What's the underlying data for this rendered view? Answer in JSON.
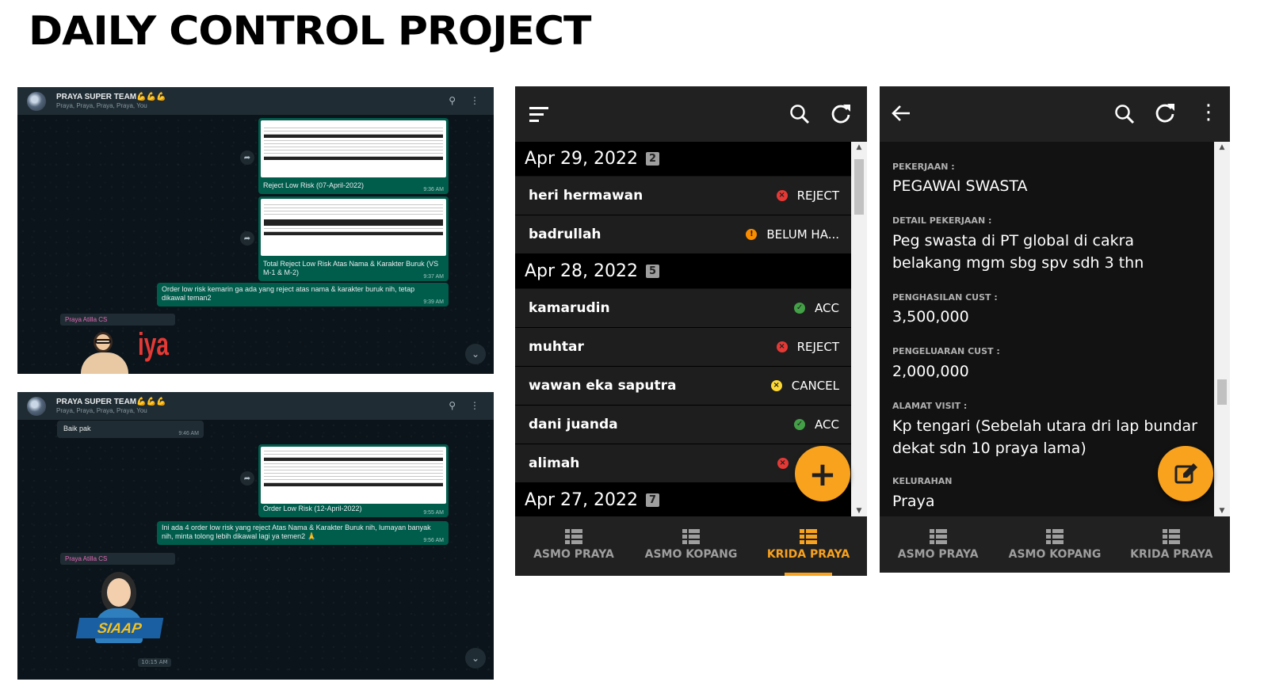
{
  "page": {
    "title": "DAILY CONTROL PROJECT"
  },
  "whatsapp_top": {
    "group_name": "PRAYA SUPER TEAM💪💪💪",
    "members": "Praya, Praya, Praya, Praya, You",
    "messages": [
      {
        "caption": "Reject Low Risk (07-April-2022)",
        "time": "9:36 AM"
      },
      {
        "caption": "Total Reject Low Risk Atas Nama & Karakter Buruk (VS M-1 & M-2)",
        "time": "9:37 AM"
      },
      {
        "text": "Order low risk kemarin ga ada yang reject atas nama & karakter buruk nih, tetap dikawal teman2",
        "time": "9:39 AM"
      }
    ],
    "sender": "Praya Atilla CS",
    "sticker_text": "iya"
  },
  "whatsapp_bottom": {
    "group_name": "PRAYA SUPER TEAM💪💪💪",
    "members": "Praya, Praya, Praya, Praya, You",
    "messages": [
      {
        "text": "Baik pak",
        "time": "9:46 AM"
      },
      {
        "caption": "Order Low Risk (12-April-2022)",
        "time": "9:55 AM"
      },
      {
        "text": "Ini ada 4 order low risk yang reject Atas Nama & Karakter Buruk nih, lumayan banyak nih, minta tolong lebih dikawal lagi ya temen2 🙏",
        "time": "9:56 AM"
      }
    ],
    "sender": "Praya Atilla CS",
    "sticker_text": "SIAAP",
    "sticker_time": "10:15 AM"
  },
  "list_app": {
    "groups": [
      {
        "date": "Apr 29, 2022",
        "count": "2",
        "rows": [
          {
            "name": "heri hermawan",
            "status": "REJECT",
            "status_icon": "reject-icon",
            "color": "#e53935"
          },
          {
            "name": "badrullah",
            "status": "BELUM HA...",
            "status_icon": "pending-icon",
            "color": "#fb8c00"
          }
        ]
      },
      {
        "date": "Apr 28, 2022",
        "count": "5",
        "rows": [
          {
            "name": "kamarudin",
            "status": "ACC",
            "status_icon": "check-icon",
            "color": "#43a047"
          },
          {
            "name": "muhtar",
            "status": "REJECT",
            "status_icon": "reject-icon",
            "color": "#e53935"
          },
          {
            "name": "wawan eka saputra",
            "status": "CANCEL",
            "status_icon": "cancel-icon",
            "color": "#fdd835"
          },
          {
            "name": "dani juanda",
            "status": "ACC",
            "status_icon": "check-icon",
            "color": "#43a047"
          },
          {
            "name": "alimah",
            "status": "R",
            "status_icon": "reject-icon",
            "color": "#e53935"
          }
        ]
      },
      {
        "date": "Apr 27, 2022",
        "count": "7",
        "rows": []
      }
    ],
    "nav": [
      "ASMO PRAYA",
      "ASMO KOPANG",
      "KRIDA PRAYA"
    ],
    "active_nav": "KRIDA PRAYA",
    "accent": "#f8a21e"
  },
  "detail_app": {
    "fields": [
      {
        "label": "PEKERJAAN :",
        "value": "PEGAWAI SWASTA"
      },
      {
        "label": "DETAIL PEKERJAAN :",
        "value": "Peg swasta di PT global di cakra belakang mgm sbg spv sdh 3 thn"
      },
      {
        "label": "PENGHASILAN CUST :",
        "value": "3,500,000"
      },
      {
        "label": "PENGELUARAN CUST :",
        "value": "2,000,000"
      },
      {
        "label": "ALAMAT VISIT :",
        "value": "Kp tengari (Sebelah utara dri lap bundar dekat sdn 10 praya lama)"
      },
      {
        "label": "KELURAHAN",
        "value": "Praya"
      }
    ],
    "nav": [
      "ASMO PRAYA",
      "ASMO KOPANG",
      "KRIDA PRAYA"
    ]
  }
}
